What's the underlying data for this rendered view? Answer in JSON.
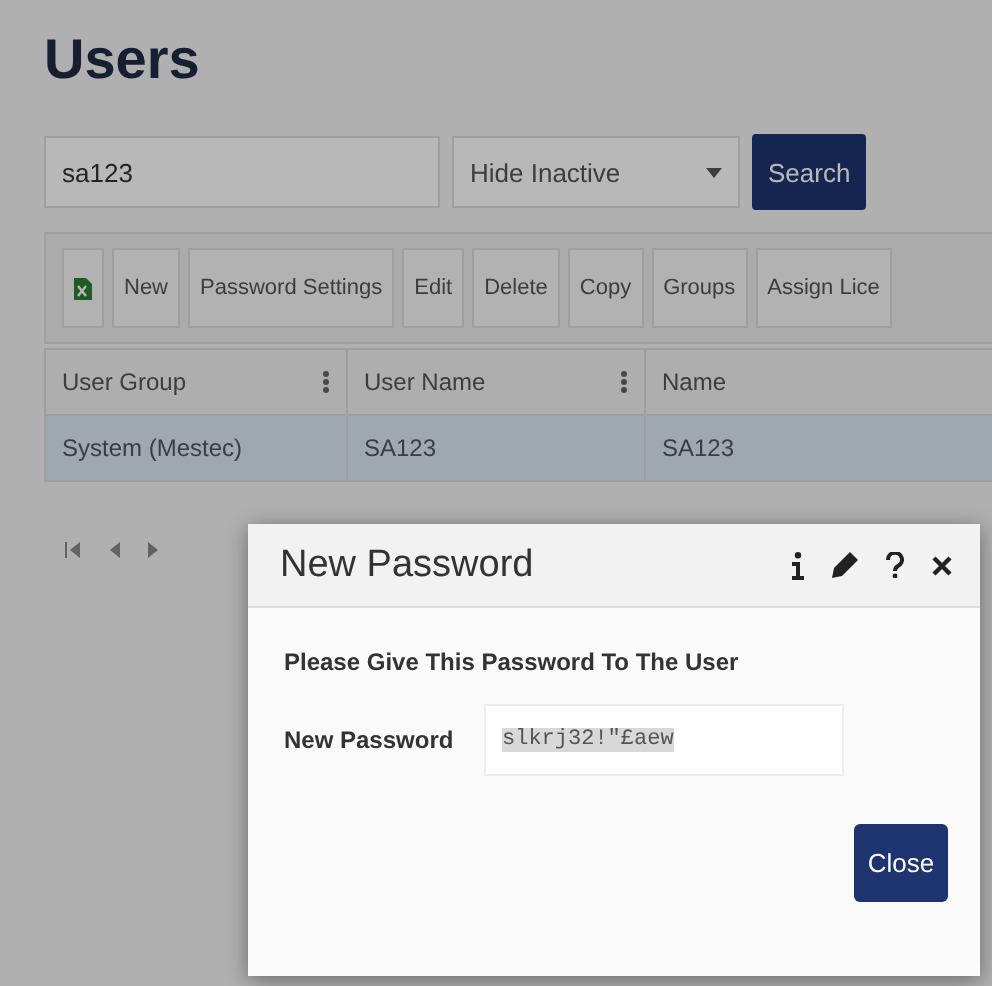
{
  "page": {
    "title": "Users"
  },
  "filters": {
    "search": {
      "value": "sa123"
    },
    "status": {
      "value": "Hide Inactive"
    },
    "search_button": "Search"
  },
  "toolbar": [
    {
      "kind": "export"
    },
    {
      "kind": "text",
      "label": "New"
    },
    {
      "kind": "text",
      "label": "Password Settings"
    },
    {
      "kind": "text",
      "label": "Edit"
    },
    {
      "kind": "text",
      "label": "Delete"
    },
    {
      "kind": "text",
      "label": "Copy"
    },
    {
      "kind": "text",
      "label": "Groups"
    },
    {
      "kind": "text",
      "label": "Assign Lice"
    }
  ],
  "table": {
    "columns": [
      {
        "label": "User Group",
        "menu": true
      },
      {
        "label": "User Name",
        "menu": true
      },
      {
        "label": "Name",
        "menu": false
      }
    ],
    "rows": [
      {
        "cells": [
          "System (Mestec)",
          "SA123",
          "SA123"
        ],
        "selected": true
      }
    ]
  },
  "dialog": {
    "title": "New Password",
    "message": "Please Give This Password To The User",
    "field": {
      "label": "New Password",
      "value": "slkrj32!\"£aew",
      "value_selected": true
    },
    "close_button": "Close"
  }
}
